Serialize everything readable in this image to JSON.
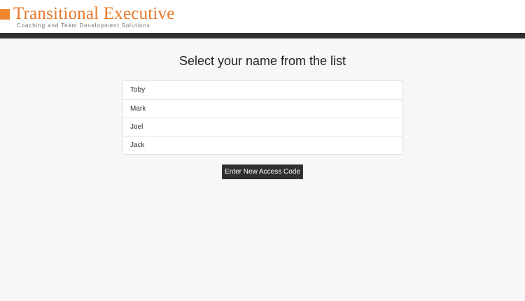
{
  "header": {
    "brand_title": "Transitional Executive",
    "brand_tagline": "Coaching and Team Development Solutions",
    "brand_color": "#e9772a",
    "bar_color": "#2e2e2e"
  },
  "main": {
    "title": "Select your name from the list",
    "names": [
      "Toby",
      "Mark",
      "Joel",
      "Jack"
    ],
    "access_button_label": "Enter New Access Code"
  }
}
